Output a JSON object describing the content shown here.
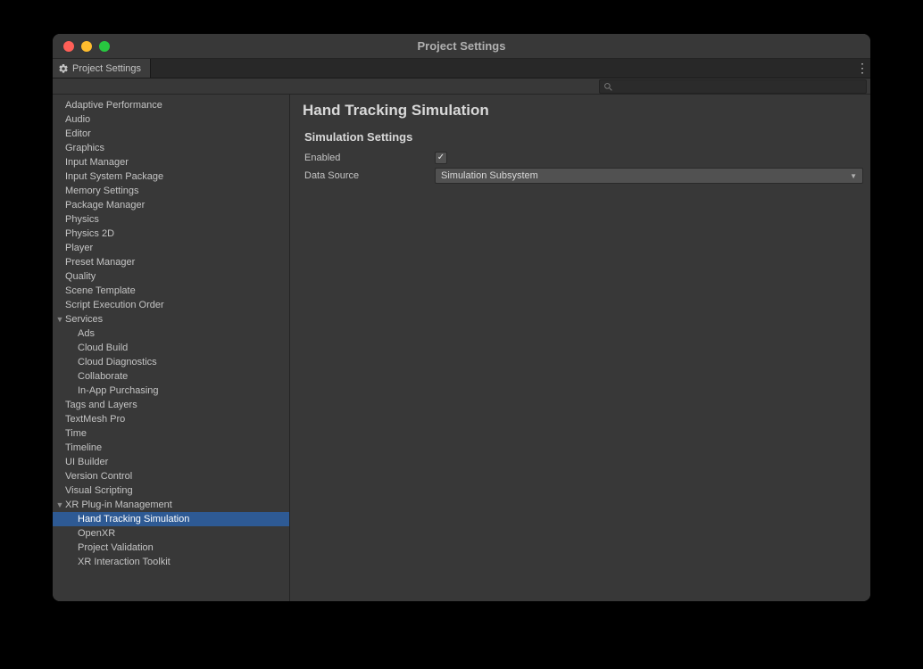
{
  "window": {
    "title": "Project Settings"
  },
  "tab": {
    "label": "Project Settings"
  },
  "search": {
    "placeholder": ""
  },
  "sidebar": {
    "items": [
      {
        "label": "Adaptive Performance",
        "indent": 0
      },
      {
        "label": "Audio",
        "indent": 0
      },
      {
        "label": "Editor",
        "indent": 0
      },
      {
        "label": "Graphics",
        "indent": 0
      },
      {
        "label": "Input Manager",
        "indent": 0
      },
      {
        "label": "Input System Package",
        "indent": 0
      },
      {
        "label": "Memory Settings",
        "indent": 0
      },
      {
        "label": "Package Manager",
        "indent": 0
      },
      {
        "label": "Physics",
        "indent": 0
      },
      {
        "label": "Physics 2D",
        "indent": 0
      },
      {
        "label": "Player",
        "indent": 0
      },
      {
        "label": "Preset Manager",
        "indent": 0
      },
      {
        "label": "Quality",
        "indent": 0
      },
      {
        "label": "Scene Template",
        "indent": 0
      },
      {
        "label": "Script Execution Order",
        "indent": 0
      },
      {
        "label": "Services",
        "indent": 0,
        "expander": "▼"
      },
      {
        "label": "Ads",
        "indent": 1
      },
      {
        "label": "Cloud Build",
        "indent": 1
      },
      {
        "label": "Cloud Diagnostics",
        "indent": 1
      },
      {
        "label": "Collaborate",
        "indent": 1
      },
      {
        "label": "In-App Purchasing",
        "indent": 1
      },
      {
        "label": "Tags and Layers",
        "indent": 0
      },
      {
        "label": "TextMesh Pro",
        "indent": 0
      },
      {
        "label": "Time",
        "indent": 0
      },
      {
        "label": "Timeline",
        "indent": 0
      },
      {
        "label": "UI Builder",
        "indent": 0
      },
      {
        "label": "Version Control",
        "indent": 0
      },
      {
        "label": "Visual Scripting",
        "indent": 0
      },
      {
        "label": "XR Plug-in Management",
        "indent": 0,
        "expander": "▼"
      },
      {
        "label": "Hand Tracking Simulation",
        "indent": 1,
        "selected": true
      },
      {
        "label": "OpenXR",
        "indent": 1
      },
      {
        "label": "Project Validation",
        "indent": 1
      },
      {
        "label": "XR Interaction Toolkit",
        "indent": 1
      }
    ]
  },
  "panel": {
    "title": "Hand Tracking Simulation",
    "section": "Simulation Settings",
    "fields": {
      "enabled_label": "Enabled",
      "enabled_value": true,
      "data_source_label": "Data Source",
      "data_source_value": "Simulation Subsystem"
    }
  }
}
